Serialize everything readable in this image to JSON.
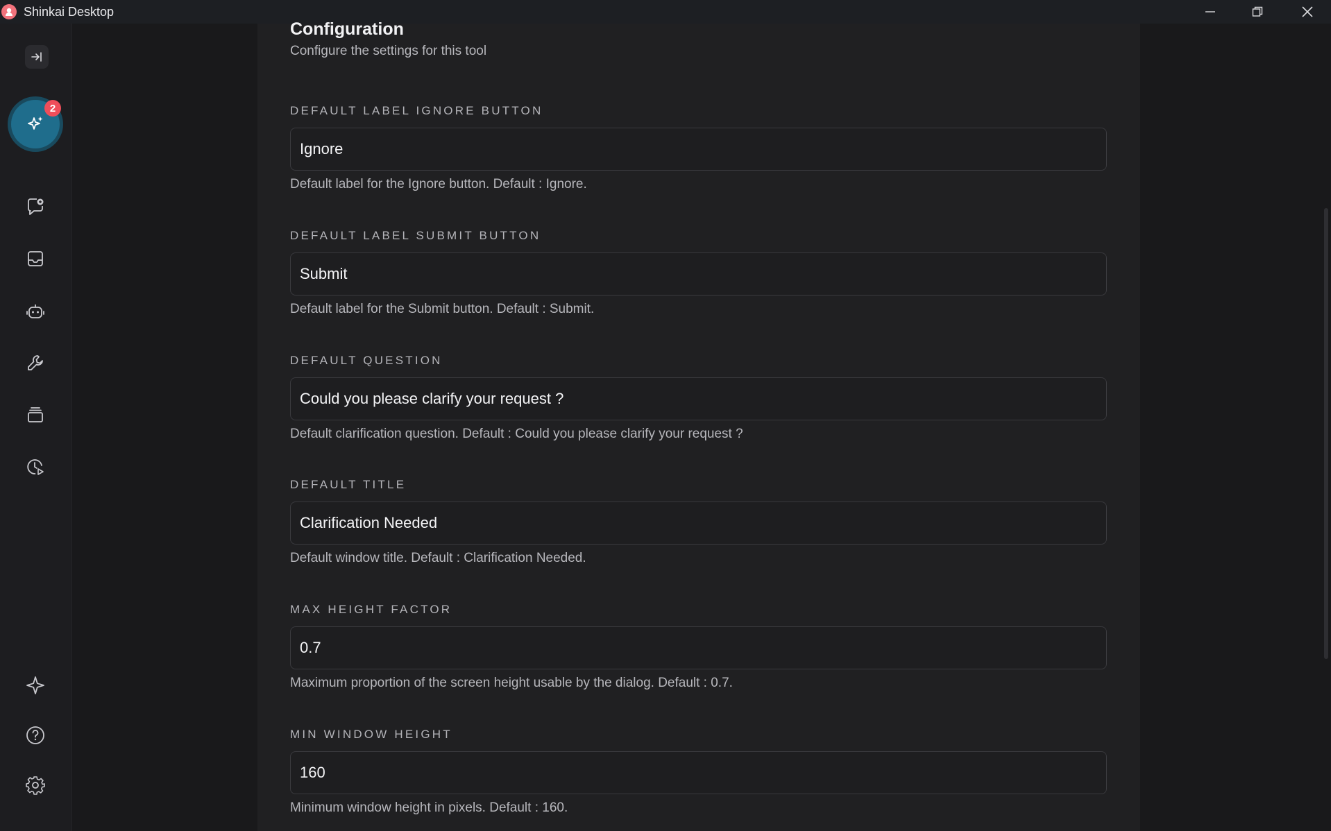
{
  "window": {
    "title": "Shinkai Desktop"
  },
  "sidebar": {
    "badge_count": "2",
    "items": [
      {
        "icon": "collapse-sidebar-icon"
      },
      {
        "icon": "sparkles-icon"
      },
      {
        "icon": "chat-plus-icon"
      },
      {
        "icon": "inbox-icon"
      },
      {
        "icon": "robot-icon"
      },
      {
        "icon": "wrench-icon"
      },
      {
        "icon": "stack-icon"
      },
      {
        "icon": "clock-play-icon"
      },
      {
        "icon": "sparkle-icon"
      },
      {
        "icon": "help-icon"
      },
      {
        "icon": "gear-icon"
      }
    ]
  },
  "config": {
    "title": "Configuration",
    "subtitle": "Configure the settings for this tool",
    "fields": [
      {
        "label": "DEFAULT LABEL IGNORE BUTTON",
        "value": "Ignore",
        "help": "Default label for the Ignore button. Default : Ignore."
      },
      {
        "label": "DEFAULT LABEL SUBMIT BUTTON",
        "value": "Submit",
        "help": "Default label for the Submit button. Default : Submit."
      },
      {
        "label": "DEFAULT QUESTION",
        "value": "Could you please clarify your request ?",
        "help": "Default clarification question. Default : Could you please clarify your request ?"
      },
      {
        "label": "DEFAULT TITLE",
        "value": "Clarification Needed",
        "help": "Default window title. Default : Clarification Needed."
      },
      {
        "label": "MAX HEIGHT FACTOR",
        "value": "0.7",
        "help": "Maximum proportion of the screen height usable by the dialog. Default : 0.7."
      },
      {
        "label": "MIN WINDOW HEIGHT",
        "value": "160",
        "help": "Minimum window height in pixels. Default : 160."
      }
    ]
  },
  "colors": {
    "accent": "#1f6d8c",
    "badge": "#ef4e5a",
    "logo": "#f2727c"
  }
}
